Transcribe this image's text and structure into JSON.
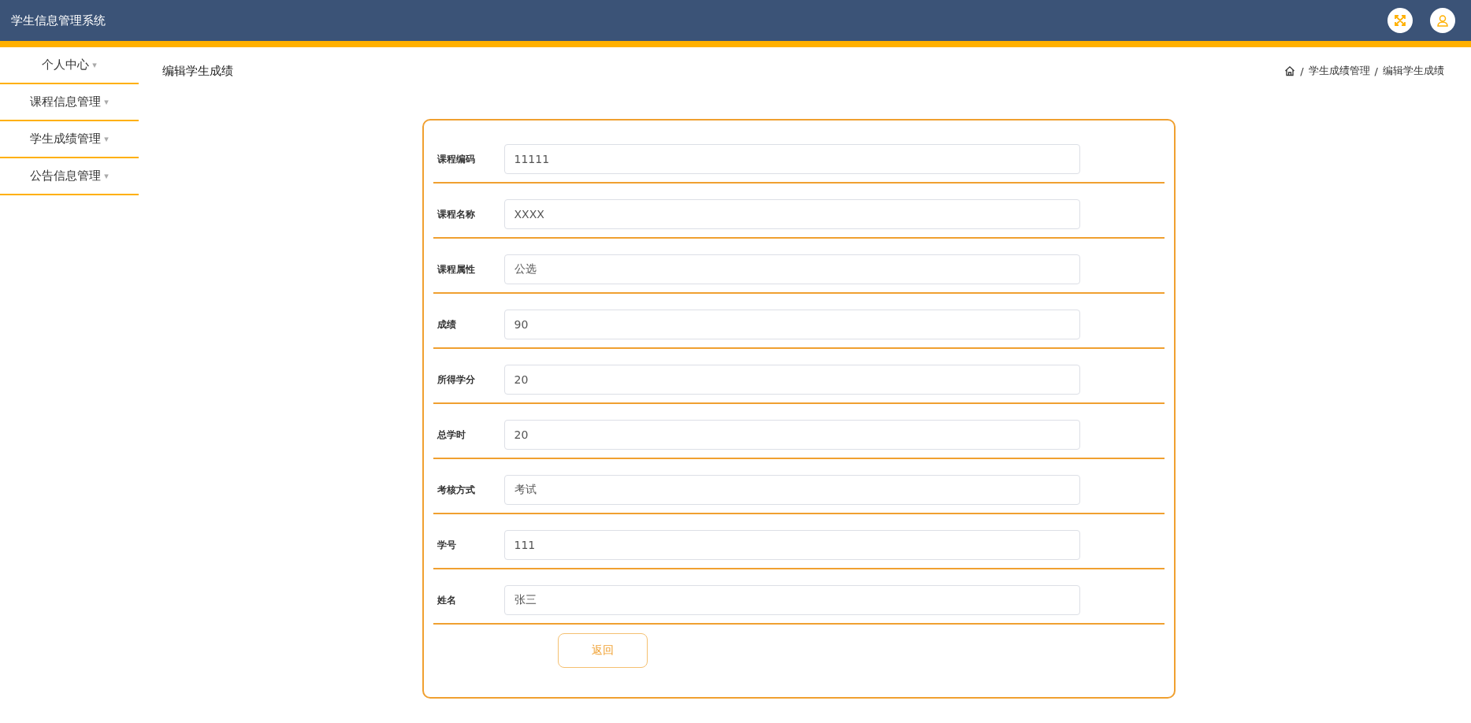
{
  "header": {
    "title": "学生信息管理系统"
  },
  "sidebar": {
    "items": [
      {
        "label": "个人中心",
        "caret": "▾"
      },
      {
        "label": "课程信息管理",
        "caret": "▾"
      },
      {
        "label": "学生成绩管理",
        "caret": "▾"
      },
      {
        "label": "公告信息管理",
        "caret": "▾"
      }
    ]
  },
  "page_title": "编辑学生成绩",
  "breadcrumb": {
    "separator": "/",
    "items": [
      "学生成绩管理",
      "编辑学生成绩"
    ]
  },
  "form": {
    "fields": [
      {
        "label": "课程编码",
        "value": "11111"
      },
      {
        "label": "课程名称",
        "value": "XXXX"
      },
      {
        "label": "课程属性",
        "value": "公选"
      },
      {
        "label": "成绩",
        "value": "90"
      },
      {
        "label": "所得学分",
        "value": "20"
      },
      {
        "label": "总学时",
        "value": "20"
      },
      {
        "label": "考核方式",
        "value": "考试"
      },
      {
        "label": "学号",
        "value": "111"
      },
      {
        "label": "姓名",
        "value": "张三"
      }
    ],
    "button": "返回"
  }
}
